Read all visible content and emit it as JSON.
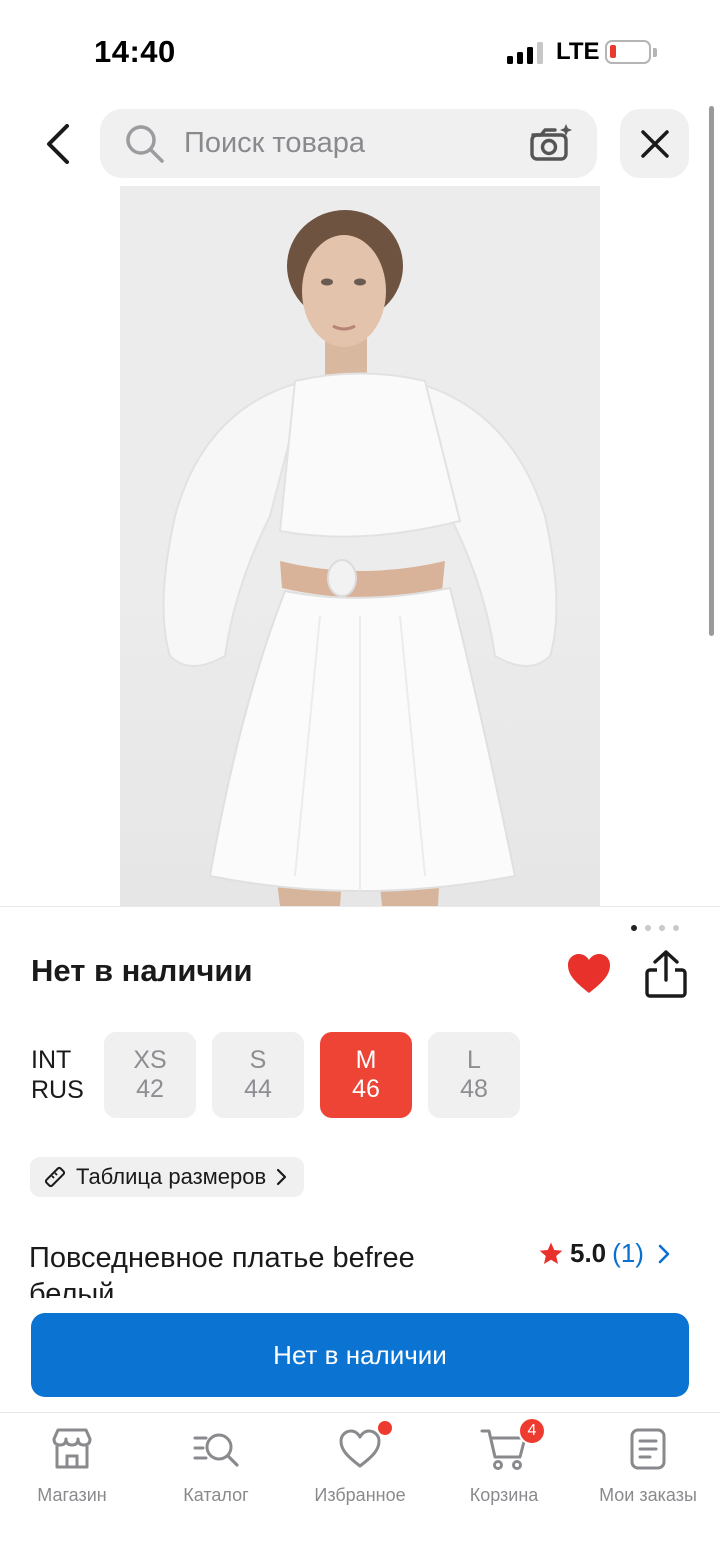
{
  "status_bar": {
    "time": "14:40",
    "network": "LTE",
    "battery_level": 0.1
  },
  "search": {
    "placeholder": "Поиск товара"
  },
  "product": {
    "availability_title": "Нет в наличии",
    "favorited": true,
    "size_systems": [
      "INT",
      "RUS"
    ],
    "sizes": [
      {
        "int": "XS",
        "rus": "42",
        "selected": false
      },
      {
        "int": "S",
        "rus": "44",
        "selected": false
      },
      {
        "int": "M",
        "rus": "46",
        "selected": true
      },
      {
        "int": "L",
        "rus": "48",
        "selected": false
      }
    ],
    "size_table_label": "Таблица размеров",
    "name": "Повседневное платье befree белый",
    "rating": {
      "score": "5.0",
      "count": "(1)"
    },
    "photo_pages": 4,
    "photo_current": 1,
    "cta_label": "Нет в наличии"
  },
  "tabbar": {
    "items": [
      {
        "label": "Магазин",
        "icon": "store-icon"
      },
      {
        "label": "Каталог",
        "icon": "catalog-search-icon"
      },
      {
        "label": "Избранное",
        "icon": "heart-icon",
        "dot": true
      },
      {
        "label": "Корзина",
        "icon": "cart-icon",
        "badge": "4"
      },
      {
        "label": "Мои заказы",
        "icon": "orders-icon"
      }
    ]
  },
  "colors": {
    "accent_blue": "#0b73d2",
    "selected_size": "#ee4436",
    "heart": "#e8312b",
    "badge": "#ee3b30"
  }
}
